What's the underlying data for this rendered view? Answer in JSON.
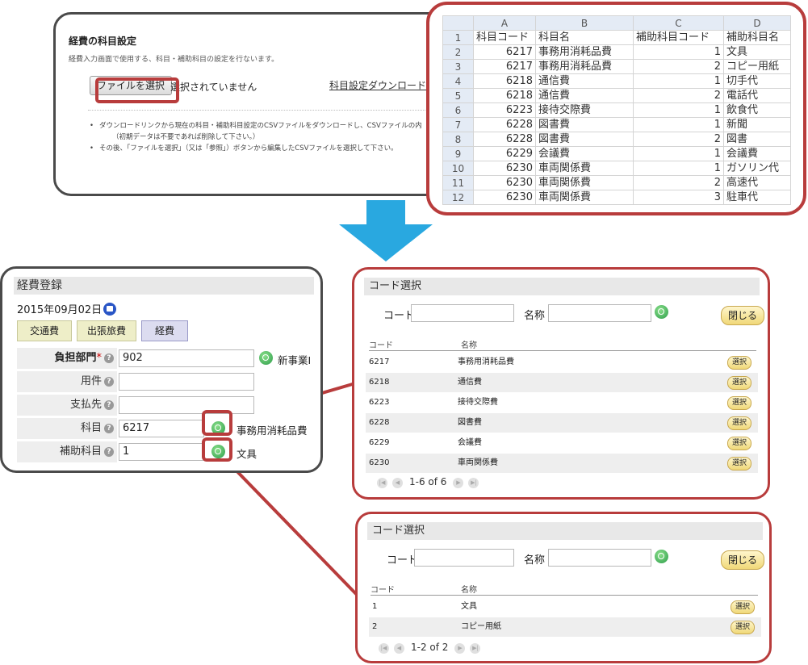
{
  "account_settings": {
    "title": "経費の科目設定",
    "description": "経費入力画面で使用する、科目・補助科目の設定を行ないます。",
    "file_button": "ファイルを選択",
    "file_status": "選択されていません",
    "download_link": "科目設定ダウンロード",
    "notes": [
      "ダウンロードリンクから現在の科目・補助科目設定のCSVファイルをダウンロードし、CSVファイルの内",
      "（初期データは不要であれば削除して下さい。）",
      "その後、「ファイルを選択」（又は「参照」）ボタンから編集したCSVファイルを選択して下さい。"
    ]
  },
  "spreadsheet": {
    "columns": [
      "A",
      "B",
      "C",
      "D"
    ],
    "rows": [
      {
        "n": "1",
        "a": "科目コード",
        "b": "科目名",
        "c": "補助科目コード",
        "d": "補助科目名"
      },
      {
        "n": "2",
        "a": "6217",
        "b": "事務用消耗品費",
        "c": "1",
        "d": "文具"
      },
      {
        "n": "3",
        "a": "6217",
        "b": "事務用消耗品費",
        "c": "2",
        "d": "コピー用紙"
      },
      {
        "n": "4",
        "a": "6218",
        "b": "通信費",
        "c": "1",
        "d": "切手代"
      },
      {
        "n": "5",
        "a": "6218",
        "b": "通信費",
        "c": "2",
        "d": "電話代"
      },
      {
        "n": "6",
        "a": "6223",
        "b": "接待交際費",
        "c": "1",
        "d": "飲食代"
      },
      {
        "n": "7",
        "a": "6228",
        "b": "図書費",
        "c": "1",
        "d": "新聞"
      },
      {
        "n": "8",
        "a": "6228",
        "b": "図書費",
        "c": "2",
        "d": "図書"
      },
      {
        "n": "9",
        "a": "6229",
        "b": "会議費",
        "c": "1",
        "d": "会議費"
      },
      {
        "n": "10",
        "a": "6230",
        "b": "車両関係費",
        "c": "1",
        "d": "ガソリン代"
      },
      {
        "n": "11",
        "a": "6230",
        "b": "車両関係費",
        "c": "2",
        "d": "高速代"
      },
      {
        "n": "12",
        "a": "6230",
        "b": "車両関係費",
        "c": "3",
        "d": "駐車代"
      }
    ]
  },
  "expense_form": {
    "title": "経費登録",
    "date": "2015年09月02日",
    "tabs": [
      "交通費",
      "出張旅費",
      "経費"
    ],
    "fields": {
      "dept_label": "負担部門",
      "dept_required": "*",
      "dept_value": "902",
      "dept_name": "新事業Ⅰ",
      "purpose_label": "用件",
      "payee_label": "支払先",
      "account_label": "科目",
      "account_value": "6217",
      "account_name": "事務用消耗品費",
      "subaccount_label": "補助科目",
      "subaccount_value": "1",
      "subaccount_name": "文具"
    }
  },
  "code_dialog_1": {
    "title": "コード選択",
    "code_label": "コード",
    "name_label": "名称",
    "close": "閉じる",
    "col_code": "コード",
    "col_name": "名称",
    "select": "選択",
    "rows": [
      {
        "code": "6217",
        "name": "事務用消耗品費"
      },
      {
        "code": "6218",
        "name": "通信費"
      },
      {
        "code": "6223",
        "name": "接待交際費"
      },
      {
        "code": "6228",
        "name": "図書費"
      },
      {
        "code": "6229",
        "name": "会議費"
      },
      {
        "code": "6230",
        "name": "車両関係費"
      }
    ],
    "pager": "1-6 of 6"
  },
  "code_dialog_2": {
    "title": "コード選択",
    "code_label": "コード",
    "name_label": "名称",
    "close": "閉じる",
    "col_code": "コード",
    "col_name": "名称",
    "select": "選択",
    "rows": [
      {
        "code": "1",
        "name": "文具"
      },
      {
        "code": "2",
        "name": "コピー用紙"
      }
    ],
    "pager": "1-2 of 2"
  },
  "colors": {
    "highlight": "#b83c3c",
    "arrow": "#29a8e0",
    "search_button": "#2c9c4a",
    "calendar_icon": "#2a56c6"
  }
}
